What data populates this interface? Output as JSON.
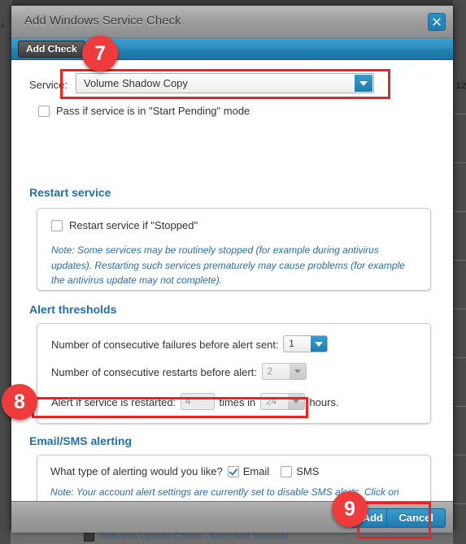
{
  "background": {
    "sidebar_label": "s",
    "right_number": "12",
    "bottom_row_text": "Antivirus Update Check - Microsoft Security"
  },
  "dialog": {
    "title": "Add Windows Service Check",
    "close_icon": "close-icon",
    "tab": {
      "label": "Add Check"
    },
    "footer": {
      "add_label": "Add",
      "cancel_label": "Cancel"
    }
  },
  "form": {
    "service": {
      "label": "Service:",
      "value": "Volume Shadow Copy",
      "arrow_icon": "chevron-down-icon"
    },
    "pass_pending": {
      "label": "Pass if service is in \"Start Pending\" mode",
      "checked": false
    },
    "restart_section": {
      "title": "Restart service",
      "checkbox_label": "Restart service if \"Stopped\"",
      "checked": false,
      "note": "Note: Some services may be routinely stopped (for example during antivirus updates). Restarting such services prematurely may cause problems (for example the antivirus update may not complete)."
    },
    "alert_section": {
      "title": "Alert thresholds",
      "row1": {
        "label": "Number of consecutive failures before alert sent:",
        "value": "1",
        "enabled": true
      },
      "row2": {
        "label": "Number of consecutive restarts before alert:",
        "value": "2",
        "enabled": false
      },
      "row3": {
        "label_before": "Alert if service is restarted:",
        "times_value": "4",
        "label_middle": "times in",
        "hours_value": "24",
        "label_after": "hours."
      }
    },
    "email_section": {
      "title": "Email/SMS alerting",
      "question": "What type of alerting would you like?",
      "email_label": "Email",
      "email_checked": true,
      "sms_label": "SMS",
      "sms_checked": false,
      "note": "Note: Your account alert settings are currently set to disable SMS alerts. Click on My account > Alerts to change Email and SMS settings."
    }
  },
  "annotations": {
    "badge_7": "7",
    "badge_8": "8",
    "badge_9": "9",
    "highlight_color": "#ee2222",
    "badge_color": "#ef3b3b"
  }
}
